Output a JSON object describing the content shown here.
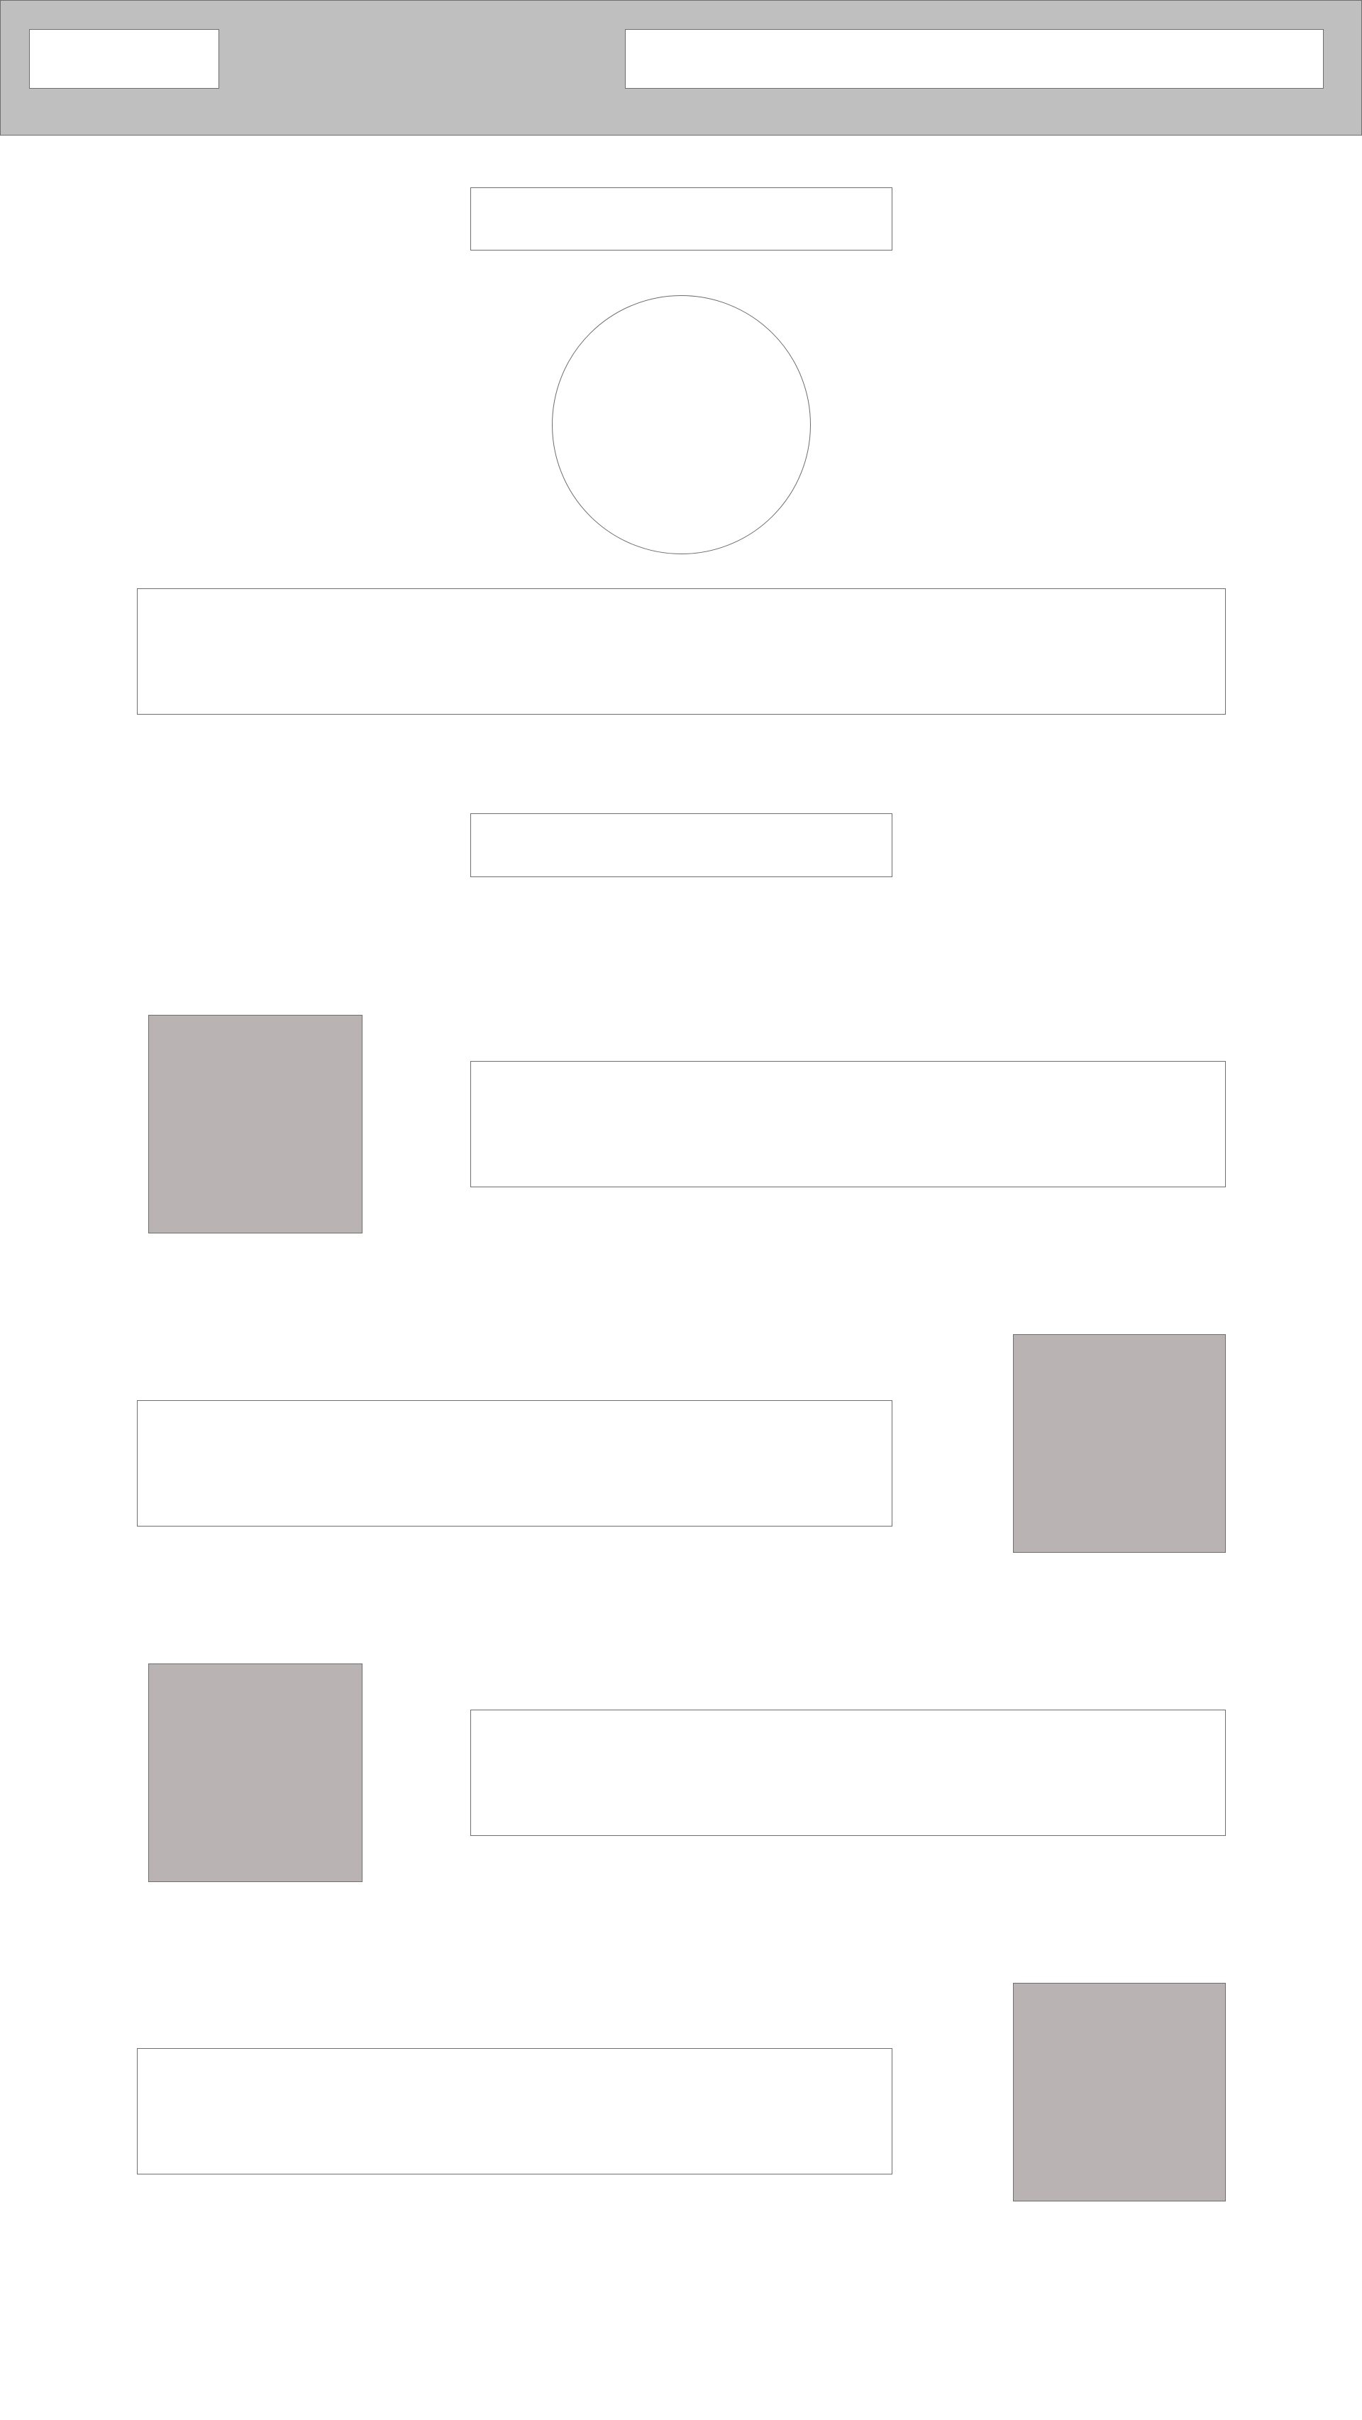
{
  "colors": {
    "header_background": "#bfbfbf",
    "image_placeholder": "#b9b4b3",
    "border": "#6e6e6e",
    "page_background": "#ffffff"
  },
  "header": {},
  "hero": {},
  "features": [
    {
      "kind": "image-left"
    },
    {
      "kind": "image-right"
    },
    {
      "kind": "image-left"
    },
    {
      "kind": "image-right"
    }
  ]
}
